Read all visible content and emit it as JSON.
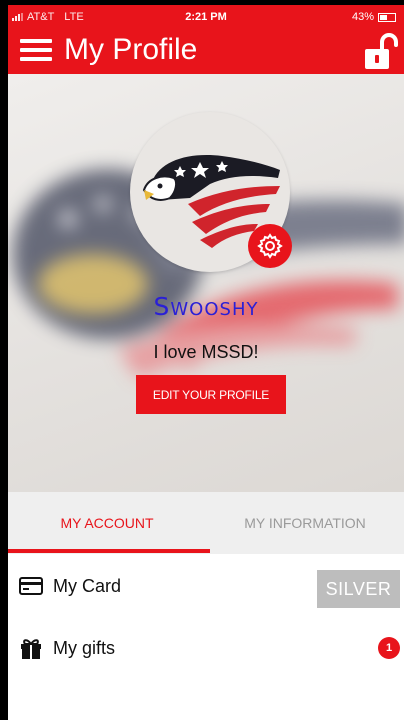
{
  "status_bar": {
    "carrier": "AT&T",
    "network": "LTE",
    "time": "2:21 PM",
    "battery": "43%"
  },
  "app_bar": {
    "title": "My Profile",
    "menu_icon": "hamburger-icon",
    "lock_icon": "unlock-icon"
  },
  "profile": {
    "username": "Swooshy",
    "motto": "I love MSSD!",
    "edit_button": "EDIT YOUR PROFILE",
    "settings_icon": "gear-icon"
  },
  "tabs": [
    {
      "label": "MY ACCOUNT",
      "active": true
    },
    {
      "label": "MY INFORMATION",
      "active": false
    }
  ],
  "account_items": [
    {
      "label": "My Card",
      "icon": "card-icon",
      "badge": "SILVER"
    },
    {
      "label": "My gifts",
      "icon": "gift-icon",
      "count": "1"
    }
  ],
  "colors": {
    "brand_red": "#e8141b",
    "username_blue": "#2a1fd6",
    "tier_gray": "#bdbdbd"
  }
}
